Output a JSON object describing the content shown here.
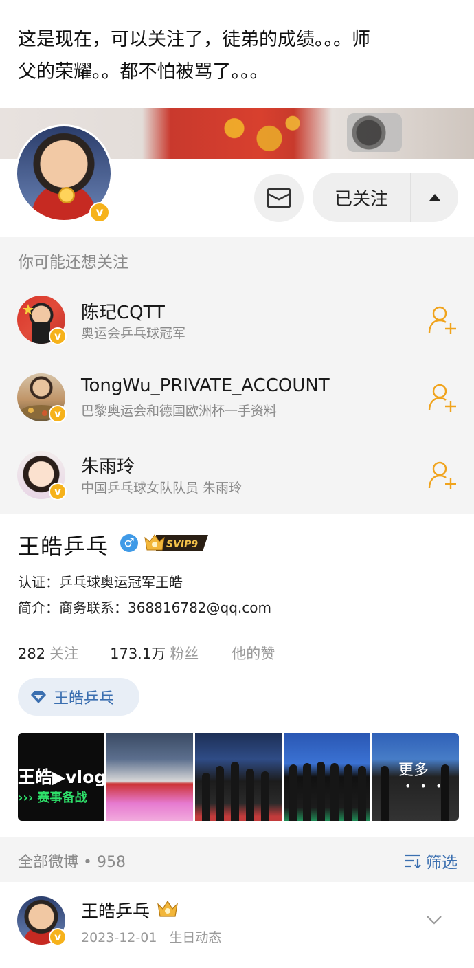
{
  "caption": {
    "line1": "这是现在，可以关注了，徒弟的成绩。。。师",
    "line2": "父的荣耀。。都不怕被骂了。。。"
  },
  "header": {
    "follow_label": "已关注"
  },
  "recommend": {
    "title": "你可能还想关注",
    "items": [
      {
        "name": "陈玘CQTT",
        "desc": "奥运会乒乓球冠军"
      },
      {
        "name": "TongWu_PRIVATE_ACCOUNT",
        "desc": "巴黎奥运会和德国欧洲杯一手资料"
      },
      {
        "name": "朱雨玲",
        "desc": "中国乒乓球女队队员 朱雨玲"
      }
    ]
  },
  "profile": {
    "name": "王皓乒乓",
    "gender_symbol": "♂",
    "vip_label": "SVIP9",
    "verify": "认证：乒乓球奥运冠军王皓",
    "intro": "简介：商务联系：368816782@qq.com",
    "stats": {
      "following_num": "282",
      "following_label": "关注",
      "followers_num": "173.1万",
      "followers_label": "粉丝",
      "likes_label": "他的赞"
    },
    "chip_label": "王皓乒乓"
  },
  "media": {
    "vlog_top": "王皓▶vlog",
    "vlog_bottom": "››› 赛事备战",
    "more_label": "更多",
    "more_dots": "• • •"
  },
  "feed": {
    "count_label": "全部微博 • 958",
    "filter_label": "筛选"
  },
  "post": {
    "author": "王皓乒乓",
    "date": "2023-12-01",
    "tag": "生日动态"
  },
  "colors": {
    "accent_blue": "#3b6fb0",
    "badge_gold": "#f6b21b",
    "panel_gray": "#f4f4f4"
  }
}
